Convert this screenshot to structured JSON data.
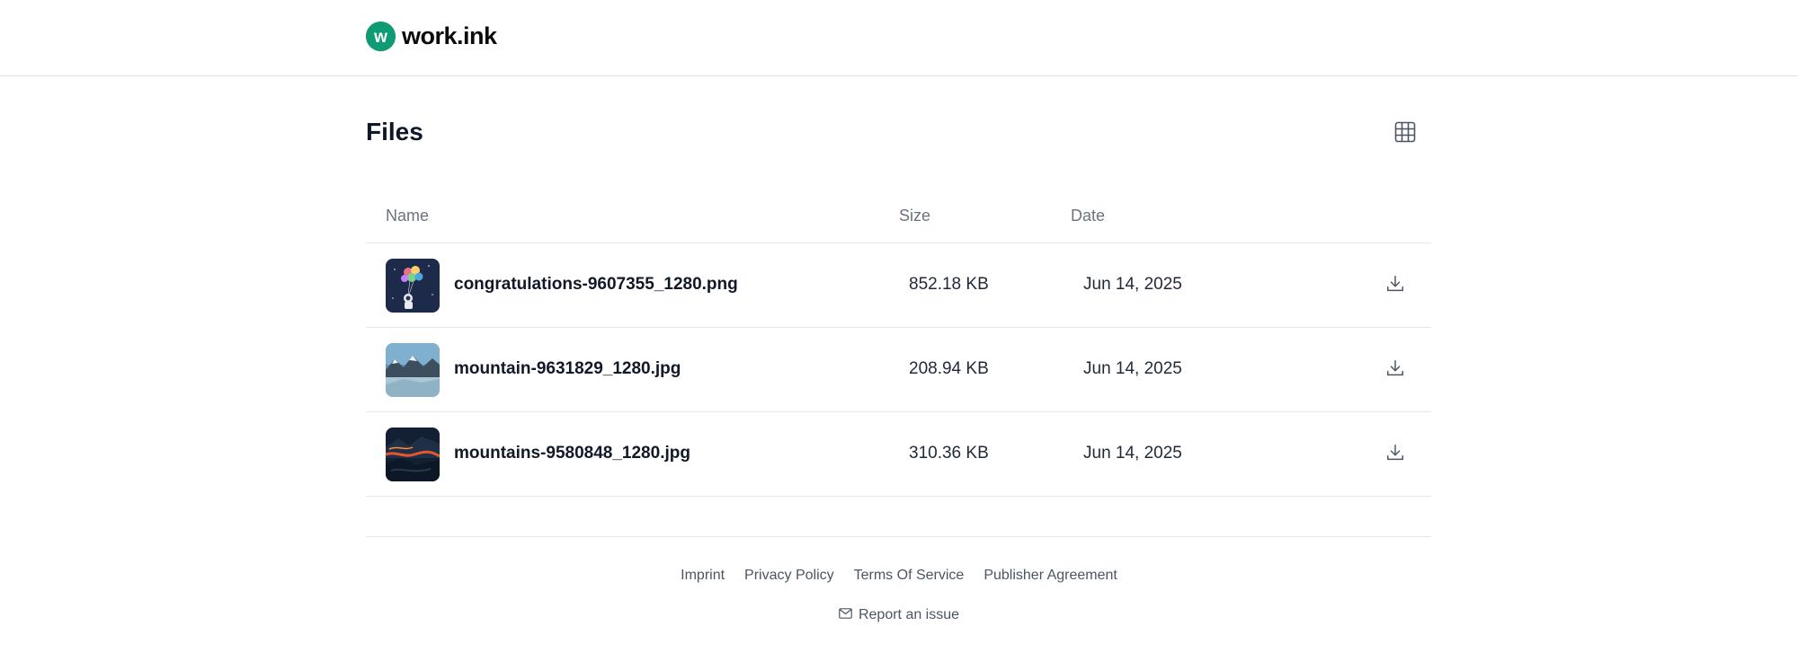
{
  "header": {
    "logo_letter": "w",
    "logo_text": "work.ink",
    "brand_color": "#0f9b74"
  },
  "page": {
    "title": "Files",
    "view_toggle_icon": "grid-icon"
  },
  "table": {
    "columns": [
      "Name",
      "Size",
      "Date"
    ],
    "rows": [
      {
        "name": "congratulations-9607355_1280.png",
        "size": "852.18 KB",
        "date": "Jun 14, 2025",
        "thumbnail": "astronaut-balloons-image"
      },
      {
        "name": "mountain-9631829_1280.jpg",
        "size": "208.94 KB",
        "date": "Jun 14, 2025",
        "thumbnail": "mountain-lake-image"
      },
      {
        "name": "mountains-9580848_1280.jpg",
        "size": "310.36 KB",
        "date": "Jun 14, 2025",
        "thumbnail": "mountains-lava-image"
      }
    ],
    "row_action_icon": "download-icon"
  },
  "footer": {
    "links": [
      "Imprint",
      "Privacy Policy",
      "Terms Of Service",
      "Publisher Agreement"
    ],
    "report_label": "Report an issue",
    "report_icon": "mail-icon"
  }
}
